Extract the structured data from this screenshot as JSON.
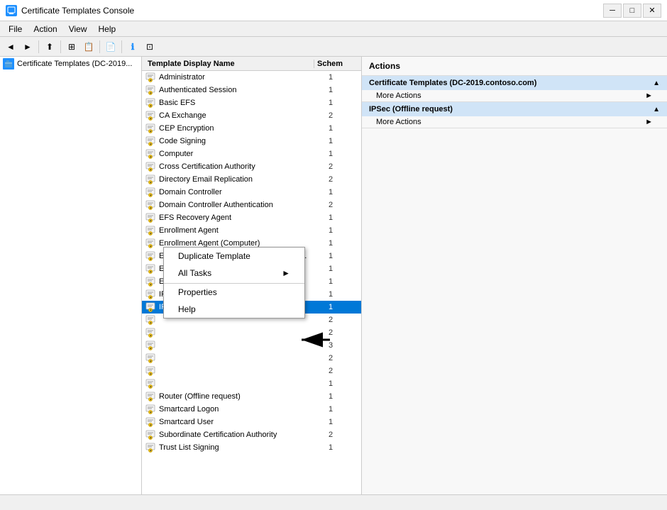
{
  "window": {
    "title": "Certificate Templates Console",
    "min_label": "─",
    "max_label": "□",
    "close_label": "✕"
  },
  "menu": {
    "items": [
      "File",
      "Action",
      "View",
      "Help"
    ]
  },
  "toolbar": {
    "buttons": [
      "◄",
      "►",
      "⊞",
      "📋",
      "📄",
      "ℹ",
      "⊡"
    ]
  },
  "left_panel": {
    "tree_item": "Certificate Templates (DC-2019..."
  },
  "list": {
    "header_name": "Template Display Name",
    "header_schema": "Schem",
    "rows": [
      {
        "name": "Administrator",
        "schema": "1"
      },
      {
        "name": "Authenticated Session",
        "schema": "1"
      },
      {
        "name": "Basic EFS",
        "schema": "1"
      },
      {
        "name": "CA Exchange",
        "schema": "2"
      },
      {
        "name": "CEP Encryption",
        "schema": "1"
      },
      {
        "name": "Code Signing",
        "schema": "1"
      },
      {
        "name": "Computer",
        "schema": "1"
      },
      {
        "name": "Cross Certification Authority",
        "schema": "2"
      },
      {
        "name": "Directory Email Replication",
        "schema": "2"
      },
      {
        "name": "Domain Controller",
        "schema": "1"
      },
      {
        "name": "Domain Controller Authentication",
        "schema": "2"
      },
      {
        "name": "EFS Recovery Agent",
        "schema": "1"
      },
      {
        "name": "Enrollment Agent",
        "schema": "1"
      },
      {
        "name": "Enrollment Agent (Computer)",
        "schema": "1"
      },
      {
        "name": "Exchange Enrollment Agent (Offline requ...",
        "schema": "1"
      },
      {
        "name": "Exchange Signature Only",
        "schema": "1"
      },
      {
        "name": "Exchange User",
        "schema": "1"
      },
      {
        "name": "IPSec",
        "schema": "1"
      },
      {
        "name": "IPSec (Offline request)",
        "schema": "1",
        "selected": true
      }
    ]
  },
  "context_menu": {
    "items": [
      {
        "label": "Duplicate Template",
        "has_arrow": false
      },
      {
        "label": "All Tasks",
        "has_arrow": true
      },
      {
        "label": "Properties",
        "has_arrow": false,
        "separator": true
      },
      {
        "label": "Help",
        "has_arrow": false
      }
    ]
  },
  "scroll_rows": [
    {
      "name": "",
      "schema": "2"
    },
    {
      "name": "",
      "schema": "2"
    },
    {
      "name": "",
      "schema": "3"
    },
    {
      "name": "",
      "schema": "2"
    },
    {
      "name": "",
      "schema": "2"
    },
    {
      "name": "",
      "schema": "1"
    }
  ],
  "visible_below_menu": [
    {
      "name": "Router (Offline request)",
      "schema": "1"
    },
    {
      "name": "Smartcard Logon",
      "schema": "1"
    },
    {
      "name": "Smartcard User",
      "schema": "1"
    },
    {
      "name": "Subordinate Certification Authority",
      "schema": "2"
    },
    {
      "name": "Trust List Signing",
      "schema": "1"
    }
  ],
  "actions": {
    "header": "Actions",
    "sections": [
      {
        "title": "Certificate Templates (DC-2019.contoso.com)",
        "more_actions_label": "More Actions",
        "collapsed": false
      },
      {
        "title": "IPSec (Offline request)",
        "more_actions_label": "More Actions",
        "collapsed": false
      }
    ]
  },
  "status_bar": {
    "text": ""
  },
  "colors": {
    "selected_bg": "#0078d7",
    "header_bg": "#d0e4f7",
    "accent": "#1e90ff"
  }
}
